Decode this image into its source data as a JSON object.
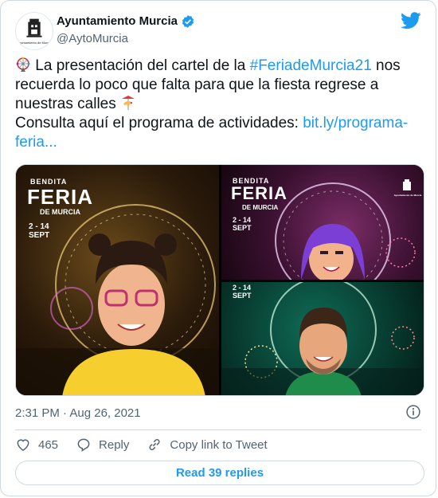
{
  "author": {
    "display_name": "Ayuntamiento Murcia",
    "handle": "@AytoMurcia",
    "avatar_caption": "Ayuntamiento de Murcia"
  },
  "tweet": {
    "line1": "La presentación del cartel de la ",
    "hashtag": "#FeriadeMurcia21",
    "line1_end": " nos recuerda lo poco que falta para que la fiesta regrese a nuestras calles ",
    "line2": "Consulta aquí el programa de actividades: ",
    "link": "bit.ly/programa-feria..."
  },
  "posters": {
    "left": {
      "brand": "BENDITA",
      "title": "FERIA",
      "subtitle": "DE MURCIA",
      "dates_line1": "2 - 14",
      "dates_line2": "SEPT"
    },
    "top_right": {
      "brand": "BENDITA",
      "title": "FERIA",
      "subtitle": "DE MURCIA",
      "dates_line1": "2 - 14",
      "dates_line2": "SEPT",
      "seal_caption": "Ayuntamiento de Murcia"
    },
    "bottom_right": {
      "dates_line1": "2 - 14",
      "dates_line2": "SEPT"
    }
  },
  "meta": {
    "timestamp": "2:31 PM · Aug 26, 2021"
  },
  "actions": {
    "like_count": "465",
    "reply_label": "Reply",
    "copy_label": "Copy link to Tweet"
  },
  "read_replies_label": "Read 39 replies",
  "colors": {
    "accent": "#1d9bf0",
    "muted": "#536471",
    "border": "#cfd9de"
  },
  "icons": [
    "ferris-wheel-emoji",
    "carousel-horse-emoji",
    "verified-badge-icon",
    "twitter-bird-icon",
    "info-icon",
    "heart-icon",
    "reply-icon",
    "link-icon"
  ]
}
